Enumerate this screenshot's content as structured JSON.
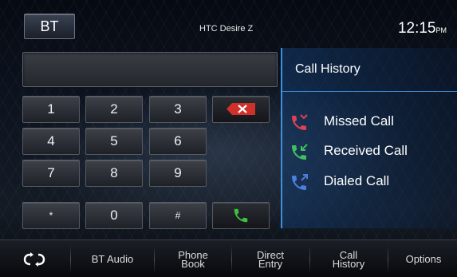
{
  "header": {
    "bt_label": "BT",
    "device_name": "HTC Desire Z",
    "time": "12:15",
    "ampm": "PM"
  },
  "number_field": {
    "value": ""
  },
  "keypad": {
    "rows": [
      [
        "1",
        "2",
        "3"
      ],
      [
        "4",
        "5",
        "6"
      ],
      [
        "7",
        "8",
        "9"
      ],
      [
        "*",
        "0",
        "#"
      ]
    ],
    "delete_icon": "delete-backspace-icon",
    "call_icon": "phone-call-icon",
    "colors": {
      "delete": "#d0302a",
      "call": "#3fbf3f"
    }
  },
  "call_history": {
    "title": "Call History",
    "items": [
      {
        "label": "Missed Call",
        "icon": "missed-call-icon",
        "color": "#e04050"
      },
      {
        "label": "Received Call",
        "icon": "received-call-icon",
        "color": "#3fbf5f"
      },
      {
        "label": "Dialed Call",
        "icon": "dialed-call-icon",
        "color": "#4a7fe0"
      }
    ]
  },
  "bottom_bar": {
    "tabs": [
      {
        "icon": "sync-arrows-icon"
      },
      {
        "label": "BT Audio"
      },
      {
        "line1": "Phone",
        "line2": "Book"
      },
      {
        "line1": "Direct",
        "line2": "Entry"
      },
      {
        "line1": "Call",
        "line2": "History"
      },
      {
        "label": "Options"
      }
    ]
  }
}
